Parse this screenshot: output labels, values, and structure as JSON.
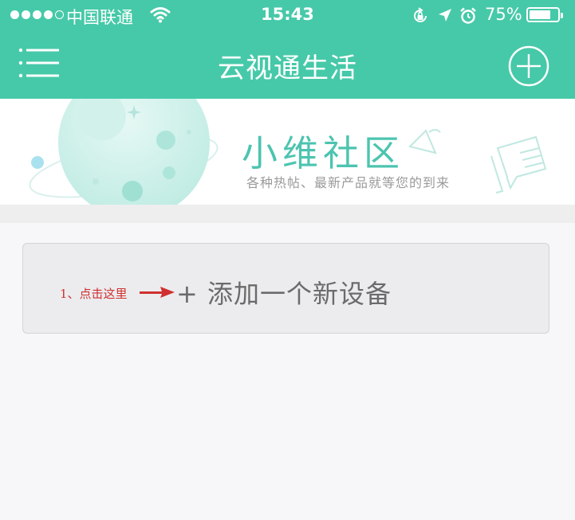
{
  "status_bar": {
    "carrier": "中国联通",
    "time": "15:43",
    "battery_percent": "75%",
    "battery_level": 0.75
  },
  "nav": {
    "title": "云视通生活",
    "menu_icon": "hamburger-menu-icon",
    "add_icon": "plus-circle-icon"
  },
  "banner": {
    "title": "小维社区",
    "subtitle": "各种热帖、最新产品就等您的到来"
  },
  "add_device": {
    "label": "+ 添加一个新设备"
  },
  "annotation": {
    "note": "1、点击这里",
    "color": "#d0302f"
  },
  "colors": {
    "header": "#46c9a8",
    "banner_accent": "#4cc4b0",
    "background": "#f7f6f9"
  }
}
